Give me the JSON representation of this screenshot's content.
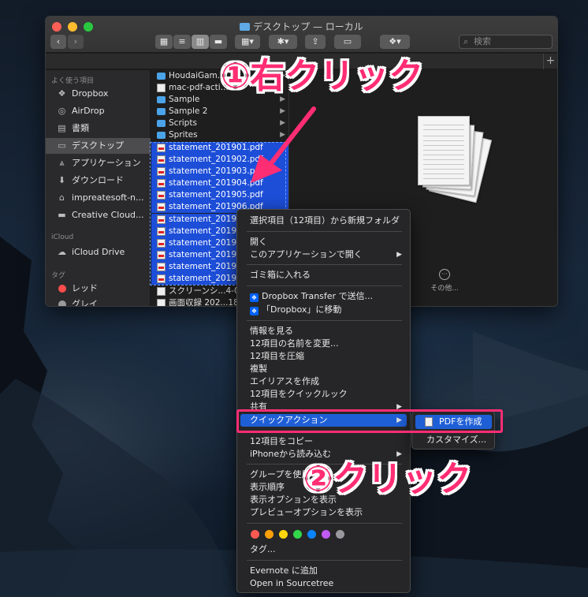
{
  "window": {
    "title": "デスクトップ — ローカル",
    "search_placeholder": "検索"
  },
  "sidebar": {
    "favorites_header": "よく使う項目",
    "favorites": [
      {
        "label": "Dropbox",
        "icon": "dropbox-icon"
      },
      {
        "label": "AirDrop",
        "icon": "airdrop-icon"
      },
      {
        "label": "書類",
        "icon": "documents-icon"
      },
      {
        "label": "デスクトップ",
        "icon": "desktop-icon",
        "active": true
      },
      {
        "label": "アプリケーション",
        "icon": "applications-icon"
      },
      {
        "label": "ダウンロード",
        "icon": "downloads-icon"
      },
      {
        "label": "impreatesoft-n...",
        "icon": "home-icon"
      },
      {
        "label": "Creative Cloud...",
        "icon": "folder-icon"
      }
    ],
    "icloud_header": "iCloud",
    "icloud_items": [
      {
        "label": "iCloud Drive",
        "icon": "cloud-icon"
      }
    ],
    "tags_header": "タグ",
    "tags": [
      {
        "label": "レッド",
        "color": "#ff4d4d"
      },
      {
        "label": "グレイ",
        "color": "#9a9a9a"
      }
    ]
  },
  "files": [
    {
      "name": "HoudaiGam...",
      "type": "folder",
      "has_children": true
    },
    {
      "name": "mac-pdf-acti...",
      "type": "doc",
      "has_children": false
    },
    {
      "name": "Sample",
      "type": "folder",
      "has_children": true
    },
    {
      "name": "Sample 2",
      "type": "folder",
      "has_children": true
    },
    {
      "name": "Scripts",
      "type": "folder",
      "has_children": true
    },
    {
      "name": "Sprites",
      "type": "folder",
      "has_children": true
    },
    {
      "name": "statement_201901.pdf",
      "type": "pdf",
      "selected": true
    },
    {
      "name": "statement_201902.pdf",
      "type": "pdf",
      "selected": true
    },
    {
      "name": "statement_201903.pdf",
      "type": "pdf",
      "selected": true
    },
    {
      "name": "statement_201904.pdf",
      "type": "pdf",
      "selected": true
    },
    {
      "name": "statement_201905.pdf",
      "type": "pdf",
      "selected": true
    },
    {
      "name": "statement_201906.pdf",
      "type": "pdf",
      "selected": true
    },
    {
      "name": "statement_20190",
      "type": "pdf",
      "selected": true
    },
    {
      "name": "statement_20190",
      "type": "pdf",
      "selected": true
    },
    {
      "name": "statement_20190",
      "type": "pdf",
      "selected": true
    },
    {
      "name": "statement_20191",
      "type": "pdf",
      "selected": true
    },
    {
      "name": "statement_20191",
      "type": "pdf",
      "selected": true
    },
    {
      "name": "statement_20191",
      "type": "pdf",
      "selected": true
    },
    {
      "name": "スクリーンシ...4-0",
      "type": "doc",
      "selected": false
    },
    {
      "name": "画面収録 202...18.",
      "type": "doc",
      "selected": false
    }
  ],
  "preview": {
    "actions": [
      {
        "label": "その他...",
        "icon": "more-icon"
      }
    ]
  },
  "context_menu": {
    "items": [
      {
        "label": "選択項目（12項目）から新規フォルダ"
      },
      {
        "sep": true
      },
      {
        "label": "開く"
      },
      {
        "label": "このアプリケーションで開く",
        "submenu": true
      },
      {
        "sep": true
      },
      {
        "label": "ゴミ箱に入れる"
      },
      {
        "sep": true
      },
      {
        "label": "Dropbox Transfer で送信...",
        "dropbox": true
      },
      {
        "label": "「Dropbox」に移動",
        "dropbox": true
      },
      {
        "sep": true
      },
      {
        "label": "情報を見る"
      },
      {
        "label": "12項目の名前を変更..."
      },
      {
        "label": "12項目を圧縮"
      },
      {
        "label": "複製"
      },
      {
        "label": "エイリアスを作成"
      },
      {
        "label": "12項目をクイックルック"
      },
      {
        "label": "共有",
        "submenu": true
      },
      {
        "label": "クイックアクション",
        "submenu": true,
        "highlighted": true
      },
      {
        "sep": true
      },
      {
        "label": "12項目をコピー"
      },
      {
        "label": "iPhoneから読み込む",
        "submenu": true
      },
      {
        "sep": true
      },
      {
        "label": "グループを使用"
      },
      {
        "label": "表示順序"
      },
      {
        "label": "表示オプションを表示"
      },
      {
        "label": "プレビューオプションを表示"
      },
      {
        "sep": true
      },
      {
        "tags": true
      },
      {
        "label": "タグ..."
      },
      {
        "sep": true
      },
      {
        "label": "Evernote に追加"
      },
      {
        "label": "Open in Sourcetree"
      }
    ],
    "tag_colors": [
      "#ff5a52",
      "#ff9f0a",
      "#ffd60a",
      "#32d74b",
      "#0a84ff",
      "#bf5af2",
      "#98989d"
    ]
  },
  "quick_action_submenu": {
    "items": [
      {
        "label": "PDFを作成",
        "highlighted": true
      },
      {
        "label": "カスタマイズ..."
      }
    ]
  },
  "annotations": {
    "step1": "①右クリック",
    "step2": "②クリック",
    "accent": "#ff2d73"
  }
}
